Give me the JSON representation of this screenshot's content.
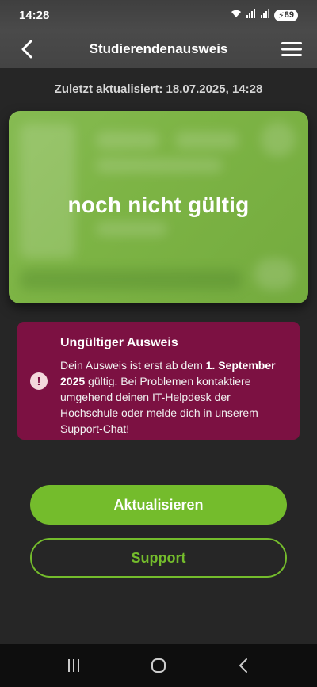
{
  "status_bar": {
    "time": "14:28",
    "battery": "89"
  },
  "header": {
    "title": "Studierendenausweis"
  },
  "updated": {
    "text": "Zuletzt aktualisiert: 18.07.2025, 14:28"
  },
  "card": {
    "status": "noch nicht gültig"
  },
  "warning": {
    "title": "Ungültiger Ausweis",
    "text_prefix": "Dein Ausweis ist erst ab dem ",
    "date": "1. September 2025",
    "text_suffix": " gültig. Bei Problemen kontaktiere umgehend deinen IT-Helpdesk der Hochschule oder melde dich in unserem Support-Chat!"
  },
  "buttons": {
    "refresh_label": "Aktualisieren",
    "support_label": "Support"
  },
  "colors": {
    "accent": "#74bc2c",
    "warning_bg": "#7c1142",
    "card_green": "#7db445"
  }
}
